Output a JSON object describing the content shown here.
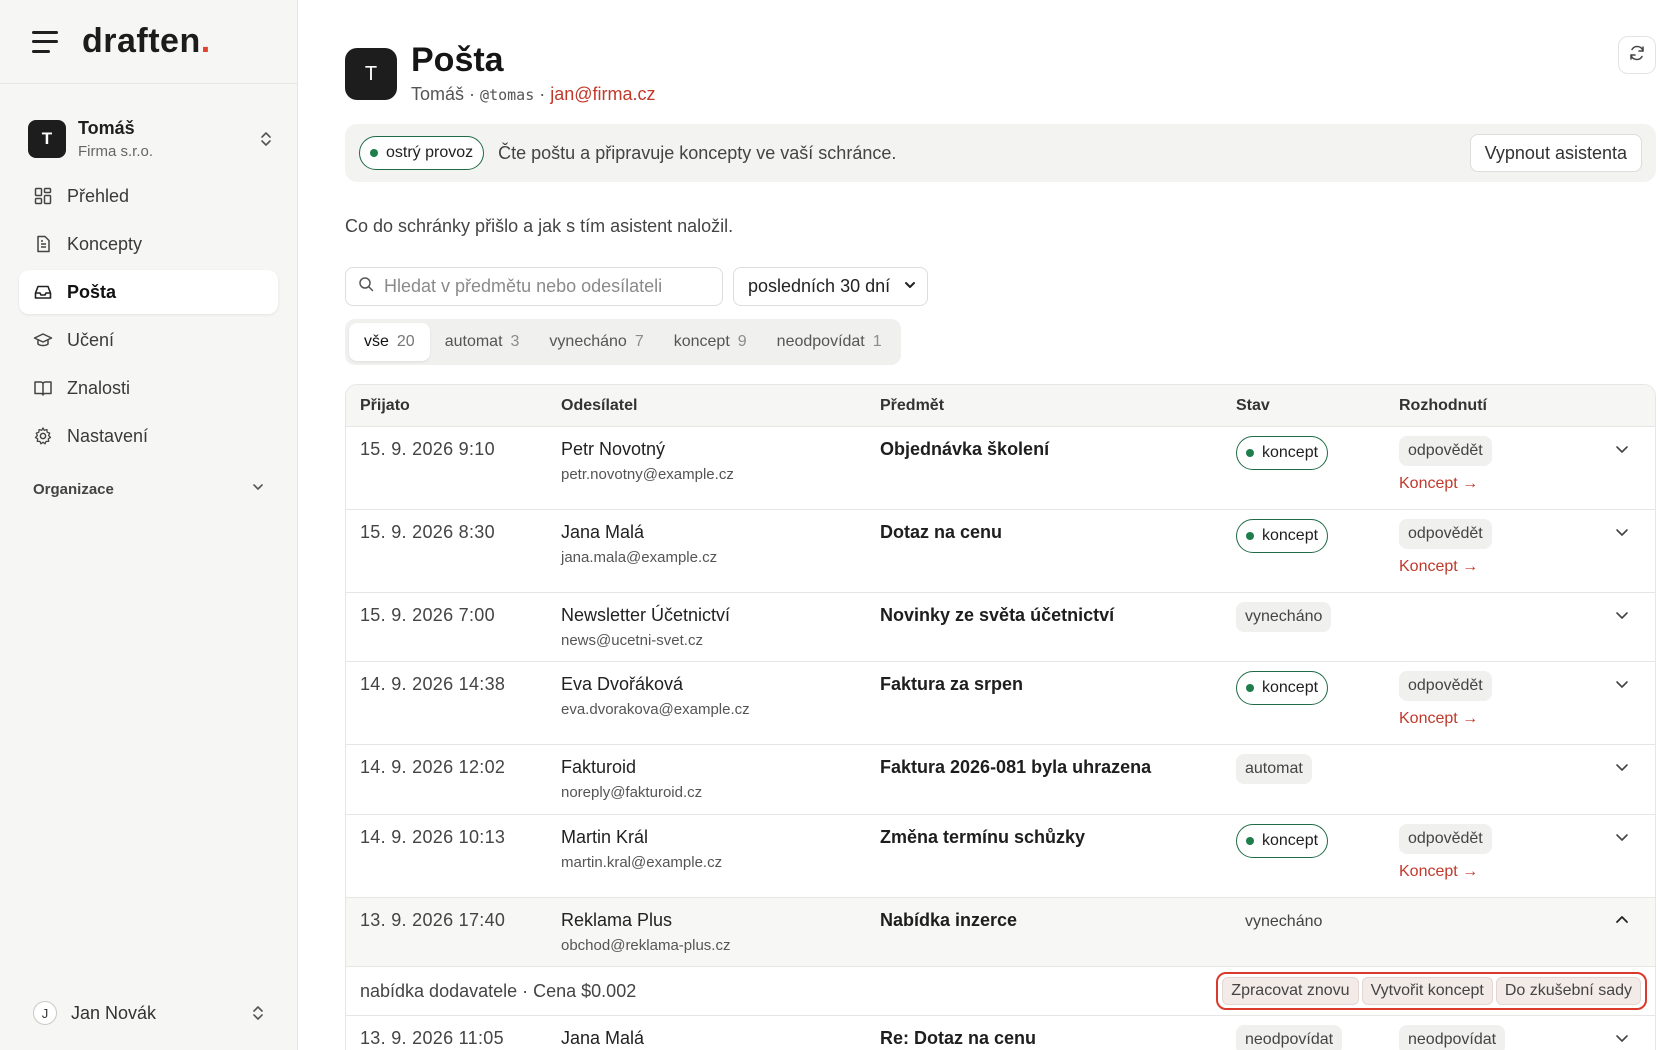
{
  "brand": {
    "logo": "draften",
    "logo_dot": "."
  },
  "account": {
    "initial": "T",
    "name": "Tomáš",
    "org": "Firma s.r.o."
  },
  "nav": {
    "items": [
      {
        "label": "Přehled",
        "icon": "grid-icon"
      },
      {
        "label": "Koncepty",
        "icon": "document-icon"
      },
      {
        "label": "Pošta",
        "icon": "inbox-icon",
        "active": true
      },
      {
        "label": "Učení",
        "icon": "graduation-cap-icon"
      },
      {
        "label": "Znalosti",
        "icon": "book-icon"
      },
      {
        "label": "Nastavení",
        "icon": "gear-icon"
      }
    ],
    "org_section": "Organizace"
  },
  "user": {
    "initial": "J",
    "name": "Jan Novák"
  },
  "header": {
    "initial": "T",
    "title": "Pošta",
    "name": "Tomáš",
    "separator": "·",
    "handle": "@tomas",
    "email": "jan@firma.cz"
  },
  "banner": {
    "status_label": "ostrý provoz",
    "text": "Čte poštu a připravuje koncepty ve vaší schránce.",
    "button": "Vypnout asistenta"
  },
  "description": "Co do schránky přišlo a jak s tím asistent naložil.",
  "search": {
    "placeholder": "Hledat v předmětu nebo odesílateli"
  },
  "period": {
    "selected": "posledních 30 dní"
  },
  "filters": [
    {
      "label": "vše",
      "count": "20",
      "active": true
    },
    {
      "label": "automat",
      "count": "3"
    },
    {
      "label": "vynecháno",
      "count": "7"
    },
    {
      "label": "koncept",
      "count": "9"
    },
    {
      "label": "neodpovídat",
      "count": "1"
    }
  ],
  "table": {
    "columns": {
      "received": "Přijato",
      "sender": "Odesílatel",
      "subject": "Předmět",
      "status": "Stav",
      "decision": "Rozhodnutí"
    },
    "rows": [
      {
        "date": "15. 9. 2026 9:10",
        "name": "Petr Novotný",
        "email": "petr.novotny@example.cz",
        "subject": "Objednávka školení",
        "status": "koncept",
        "decision": "odpovědět",
        "link": "Koncept →"
      },
      {
        "date": "15. 9. 2026 8:30",
        "name": "Jana Malá",
        "email": "jana.mala@example.cz",
        "subject": "Dotaz na cenu",
        "status": "koncept",
        "decision": "odpovědět",
        "link": "Koncept →"
      },
      {
        "date": "15. 9. 2026 7:00",
        "name": "Newsletter Účetnictví",
        "email": "news@ucetni-svet.cz",
        "subject": "Novinky ze světa účetnictví",
        "status": "vynecháno",
        "decision": "",
        "link": ""
      },
      {
        "date": "14. 9. 2026 14:38",
        "name": "Eva Dvořáková",
        "email": "eva.dvorakova@example.cz",
        "subject": "Faktura za srpen",
        "status": "koncept",
        "decision": "odpovědět",
        "link": "Koncept →"
      },
      {
        "date": "14. 9. 2026 12:02",
        "name": "Fakturoid",
        "email": "noreply@fakturoid.cz",
        "subject": "Faktura 2026-081 byla uhrazena",
        "status": "automat",
        "decision": "",
        "link": ""
      },
      {
        "date": "14. 9. 2026 10:13",
        "name": "Martin Král",
        "email": "martin.kral@example.cz",
        "subject": "Změna termínu schůzky",
        "status": "koncept",
        "decision": "odpovědět",
        "link": "Koncept →"
      },
      {
        "date": "13. 9. 2026 17:40",
        "name": "Reklama Plus",
        "email": "obchod@reklama-plus.cz",
        "subject": "Nabídka inzerce",
        "status": "vynecháno",
        "decision": "",
        "link": ""
      },
      {
        "date": "13. 9. 2026 11:05",
        "name": "Jana Malá",
        "email": "",
        "subject": "Re: Dotaz na cenu",
        "status": "neodpovídat",
        "decision": "neodpovídat",
        "link": ""
      }
    ],
    "detail": {
      "text": "nabídka dodavatele · Cena $0.002",
      "actions": [
        "Zpracovat znovu",
        "Vytvořit koncept",
        "Do zkušební sady"
      ]
    }
  },
  "colors": {
    "accent_red": "#c0392b",
    "live_green": "#1e7d4a",
    "highlight_border": "#d93a2b"
  }
}
